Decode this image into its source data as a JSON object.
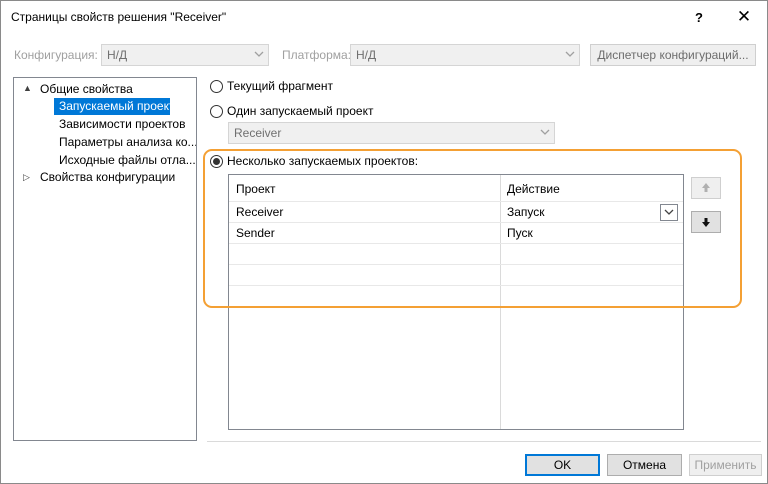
{
  "window": {
    "title": "Страницы свойств решения \"Receiver\"",
    "help_label": "?",
    "close_label": "✕"
  },
  "toolbar": {
    "configuration_label": "Конфигурация:",
    "configuration_value": "Н/Д",
    "platform_label": "Платформа:",
    "platform_value": "Н/Д",
    "config_manager_label": "Диспетчер конфигураций..."
  },
  "tree": {
    "items": [
      {
        "label": "Общие свойства",
        "expander": "▲"
      },
      {
        "label": "Запускаемый проект"
      },
      {
        "label": "Зависимости проектов"
      },
      {
        "label": "Параметры анализа ко..."
      },
      {
        "label": "Исходные файлы отла..."
      },
      {
        "label": "Свойства конфигурации",
        "expander": "▷"
      }
    ]
  },
  "startup": {
    "current_selection_label": "Текущий фрагмент",
    "single_project_label": "Один запускаемый проект",
    "single_project_value": "Receiver",
    "multiple_projects_label": "Несколько запускаемых проектов:",
    "selected_option": "multiple"
  },
  "grid": {
    "columns": [
      "Проект",
      "Действие"
    ],
    "rows": [
      {
        "project": "Receiver",
        "action": "Запуск"
      },
      {
        "project": "Sender",
        "action": "Пуск"
      }
    ]
  },
  "buttons": {
    "ok": "OK",
    "cancel": "Отмена",
    "apply": "Применить"
  },
  "colors": {
    "accent": "#0078d7",
    "highlight_frame": "#f4a034"
  },
  "icons": {
    "move_up": "arrow-up-icon",
    "move_down": "arrow-down-icon",
    "dropdown": "chevron-down-icon"
  }
}
